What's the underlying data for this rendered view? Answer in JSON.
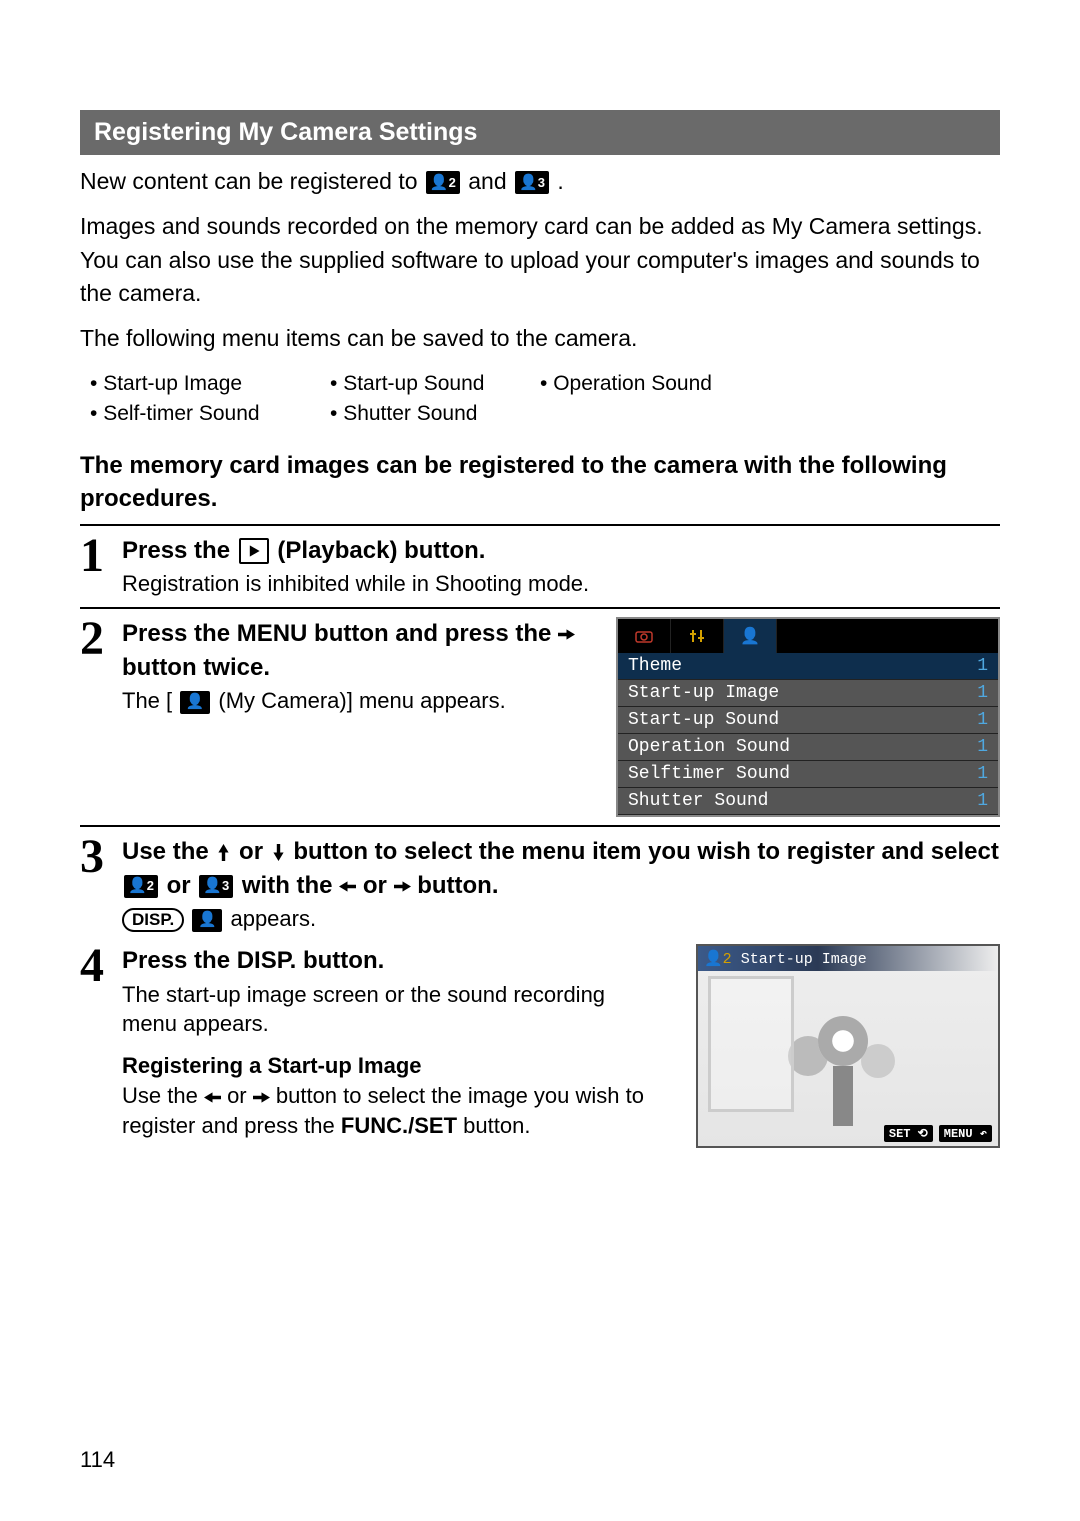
{
  "section_title": "Registering My Camera Settings",
  "intro_line": {
    "part1": "New content can be registered to ",
    "icon1_label": "2",
    "mid": " and ",
    "icon2_label": "3",
    "end": "."
  },
  "intro_para": "Images and sounds recorded on the memory card can be added as My Camera settings. You can also use the supplied software to upload your computer's images and sounds to the camera.",
  "intro_note": "The following menu items can be saved to the camera.",
  "menu_items": [
    "Start-up Image",
    "Start-up Sound",
    "Operation Sound",
    "Self-timer Sound",
    "Shutter Sound"
  ],
  "procedures_title": "The memory card images can be registered to the camera with the following procedures.",
  "steps": {
    "s1": {
      "num": "1",
      "head_a": "Press the ",
      "head_b": " (Playback) button.",
      "desc": "Registration is inhibited while in Shooting mode."
    },
    "s2": {
      "num": "2",
      "head_a": "Press the MENU button and press the ",
      "head_b": " button twice.",
      "desc_a": "The [",
      "desc_b": "(My Camera)] menu appears."
    },
    "s3": {
      "num": "3",
      "head_a": "Use the ",
      "head_b": " or ",
      "head_c": " button to select the menu item you wish to register and select ",
      "head_d": " or ",
      "head_e": " with the ",
      "head_f": " or ",
      "head_g": " button.",
      "disp_label": "DISP.",
      "appears": " appears."
    },
    "s4": {
      "num": "4",
      "head": "Press the DISP. button.",
      "desc": "The start-up image screen or the sound recording menu appears.",
      "sub_head": "Registering a Start-up Image",
      "sub_a": "Use the ",
      "sub_b": " or ",
      "sub_c": " button to select the image you wish to register and press the ",
      "funcset": "FUNC./SET",
      "sub_d": " button."
    }
  },
  "camera_menu": {
    "rows": [
      {
        "label": "Theme",
        "val": "1"
      },
      {
        "label": "Start-up Image",
        "val": "1"
      },
      {
        "label": "Start-up Sound",
        "val": "1"
      },
      {
        "label": "Operation Sound",
        "val": "1"
      },
      {
        "label": "Selftimer Sound",
        "val": "1"
      },
      {
        "label": "Shutter Sound",
        "val": "1"
      }
    ]
  },
  "startup_preview": {
    "title": " Start-up Image",
    "set": "SET",
    "menu": "MENU"
  },
  "page_number": "114"
}
